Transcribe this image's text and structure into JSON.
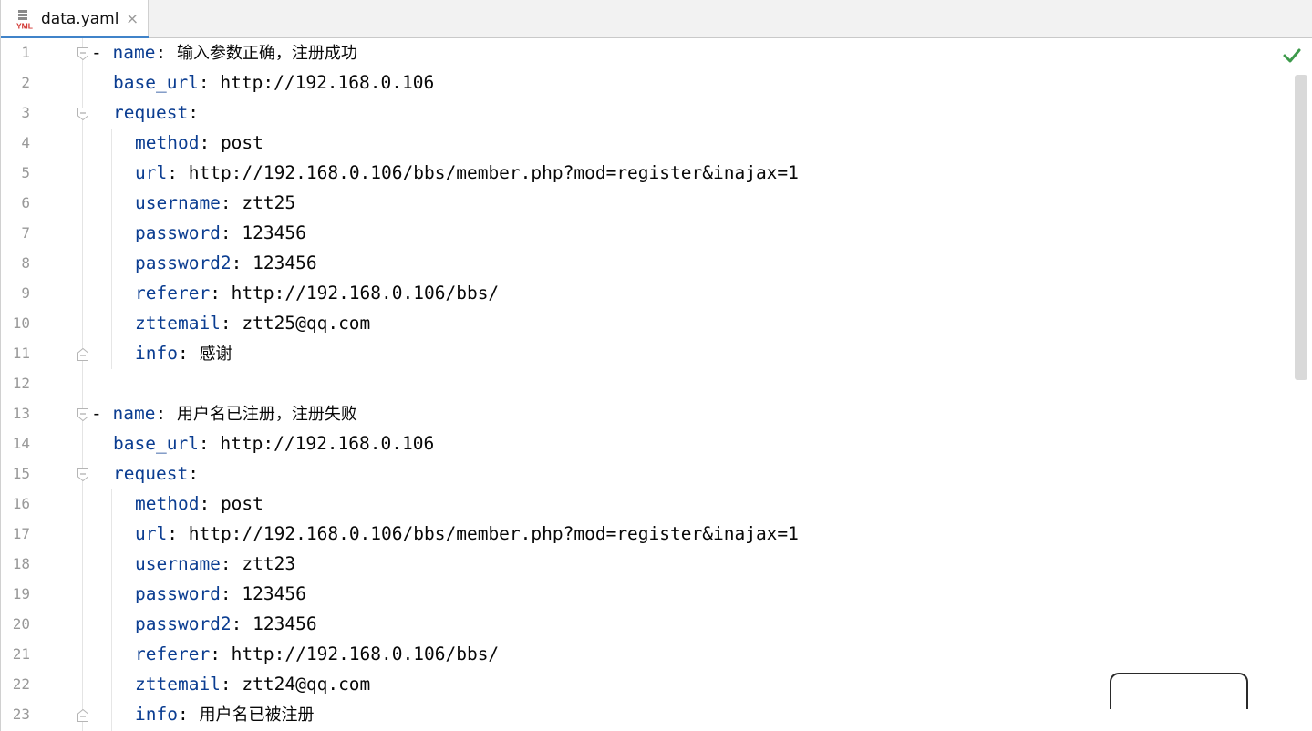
{
  "tab": {
    "icon": "yml-file-icon",
    "icon_text": "YML",
    "label": "data.yaml",
    "close": "×"
  },
  "status": {
    "inspection_icon": "check-icon"
  },
  "lines": [
    {
      "n": "1",
      "dash": "- ",
      "key": "name",
      "sep": ": ",
      "value": "输入参数正确，注册成功",
      "cjk": true
    },
    {
      "n": "2",
      "dash": "",
      "key": "base_url",
      "sep": ": ",
      "value": "http://192.168.0.106"
    },
    {
      "n": "3",
      "dash": "",
      "key": "request",
      "sep": ":",
      "value": ""
    },
    {
      "n": "4",
      "dash": "",
      "key": "method",
      "sep": ": ",
      "value": "post"
    },
    {
      "n": "5",
      "dash": "",
      "key": "url",
      "sep": ": ",
      "value": "http://192.168.0.106/bbs/member.php?mod=register&inajax=1"
    },
    {
      "n": "6",
      "dash": "",
      "key": "username",
      "sep": ": ",
      "value": "ztt25"
    },
    {
      "n": "7",
      "dash": "",
      "key": "password",
      "sep": ": ",
      "value": "123456"
    },
    {
      "n": "8",
      "dash": "",
      "key": "password2",
      "sep": ": ",
      "value": "123456"
    },
    {
      "n": "9",
      "dash": "",
      "key": "referer",
      "sep": ": ",
      "value": "http://192.168.0.106/bbs/"
    },
    {
      "n": "10",
      "dash": "",
      "key": "zttemail",
      "sep": ": ",
      "value": "ztt25@qq.com"
    },
    {
      "n": "11",
      "dash": "",
      "key": "info",
      "sep": ": ",
      "value": "感谢",
      "cjk": true
    },
    {
      "n": "12",
      "dash": "",
      "key": "",
      "sep": "",
      "value": ""
    },
    {
      "n": "13",
      "dash": "- ",
      "key": "name",
      "sep": ": ",
      "value": "用户名已注册，注册失败",
      "cjk": true
    },
    {
      "n": "14",
      "dash": "",
      "key": "base_url",
      "sep": ": ",
      "value": "http://192.168.0.106"
    },
    {
      "n": "15",
      "dash": "",
      "key": "request",
      "sep": ":",
      "value": ""
    },
    {
      "n": "16",
      "dash": "",
      "key": "method",
      "sep": ": ",
      "value": "post"
    },
    {
      "n": "17",
      "dash": "",
      "key": "url",
      "sep": ": ",
      "value": "http://192.168.0.106/bbs/member.php?mod=register&inajax=1"
    },
    {
      "n": "18",
      "dash": "",
      "key": "username",
      "sep": ": ",
      "value": "ztt23"
    },
    {
      "n": "19",
      "dash": "",
      "key": "password",
      "sep": ": ",
      "value": "123456"
    },
    {
      "n": "20",
      "dash": "",
      "key": "password2",
      "sep": ": ",
      "value": "123456"
    },
    {
      "n": "21",
      "dash": "",
      "key": "referer",
      "sep": ": ",
      "value": "http://192.168.0.106/bbs/"
    },
    {
      "n": "22",
      "dash": "",
      "key": "zttemail",
      "sep": ": ",
      "value": "ztt24@qq.com"
    },
    {
      "n": "23",
      "dash": "",
      "key": "info",
      "sep": ": ",
      "value": "用户名已被注册",
      "cjk": true
    }
  ]
}
